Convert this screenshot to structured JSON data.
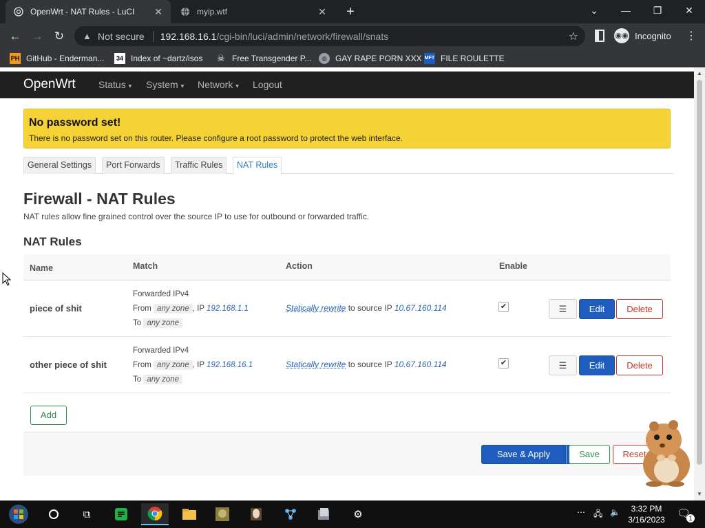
{
  "browser": {
    "tabs": [
      {
        "title": "OpenWrt - NAT Rules - LuCI",
        "active": true
      },
      {
        "title": "myip.wtf",
        "active": false
      }
    ],
    "address": {
      "security_label": "Not secure",
      "host": "192.168.16.1",
      "path": "/cgi-bin/luci/admin/network/firewall/snats"
    },
    "profile_label": "Incognito",
    "bookmarks": [
      {
        "label": "GitHub - Enderman...",
        "icon": "PH"
      },
      {
        "label": "Index of ~dartz/isos",
        "icon": "34"
      },
      {
        "label": "Free Transgender P...",
        "icon": "skull"
      },
      {
        "label": "GAY RAPE PORN XXX",
        "icon": "globe"
      },
      {
        "label": "FILE ROULETTE",
        "icon": "MFT"
      }
    ]
  },
  "luci": {
    "brand": "OpenWrt",
    "menu": [
      "Status",
      "System",
      "Network",
      "Logout"
    ],
    "alert": {
      "title": "No password set!",
      "text": "There is no password set on this router. Please configure a root password to protect the web interface."
    },
    "tabs": [
      "General Settings",
      "Port Forwards",
      "Traffic Rules",
      "NAT Rules"
    ],
    "active_tab": "NAT Rules",
    "page_title": "Firewall - NAT Rules",
    "page_description": "NAT rules allow fine grained control over the source IP to use for outbound or forwarded traffic.",
    "section_title": "NAT Rules",
    "columns": [
      "Name",
      "Match",
      "Action",
      "Enable"
    ],
    "rows": [
      {
        "name": "piece of shit",
        "match_family": "Forwarded IPv4",
        "from_label": "From",
        "from_zone": "any zone",
        "ip_label": ", IP",
        "ip": "192.168.1.1",
        "to_label": "To",
        "to_zone": "any zone",
        "action_link": "Statically rewrite",
        "action_text": "to source IP",
        "action_ip": "10.67.160.114",
        "enabled": true
      },
      {
        "name": "other piece of shit",
        "match_family": "Forwarded IPv4",
        "from_label": "From",
        "from_zone": "any zone",
        "ip_label": ", IP",
        "ip": "192.168.16.1",
        "to_label": "To",
        "to_zone": "any zone",
        "action_link": "Statically rewrite",
        "action_text": "to source IP",
        "action_ip": "10.67.160.114",
        "enabled": true
      }
    ],
    "row_buttons": {
      "drag": "☰",
      "edit": "Edit",
      "delete": "Delete"
    },
    "add_label": "Add",
    "footer": {
      "save_apply": "Save & Apply",
      "save": "Save",
      "reset": "Reset"
    }
  },
  "taskbar": {
    "clock_time": "3:32 PM",
    "clock_date": "3/16/2023",
    "notification_count": "1"
  },
  "colors": {
    "alert_bg": "#f5d236",
    "primary_button": "#1e5dbd",
    "positive": "#2e8b4f",
    "negative": "#c4382c",
    "link": "#2b63b0"
  }
}
